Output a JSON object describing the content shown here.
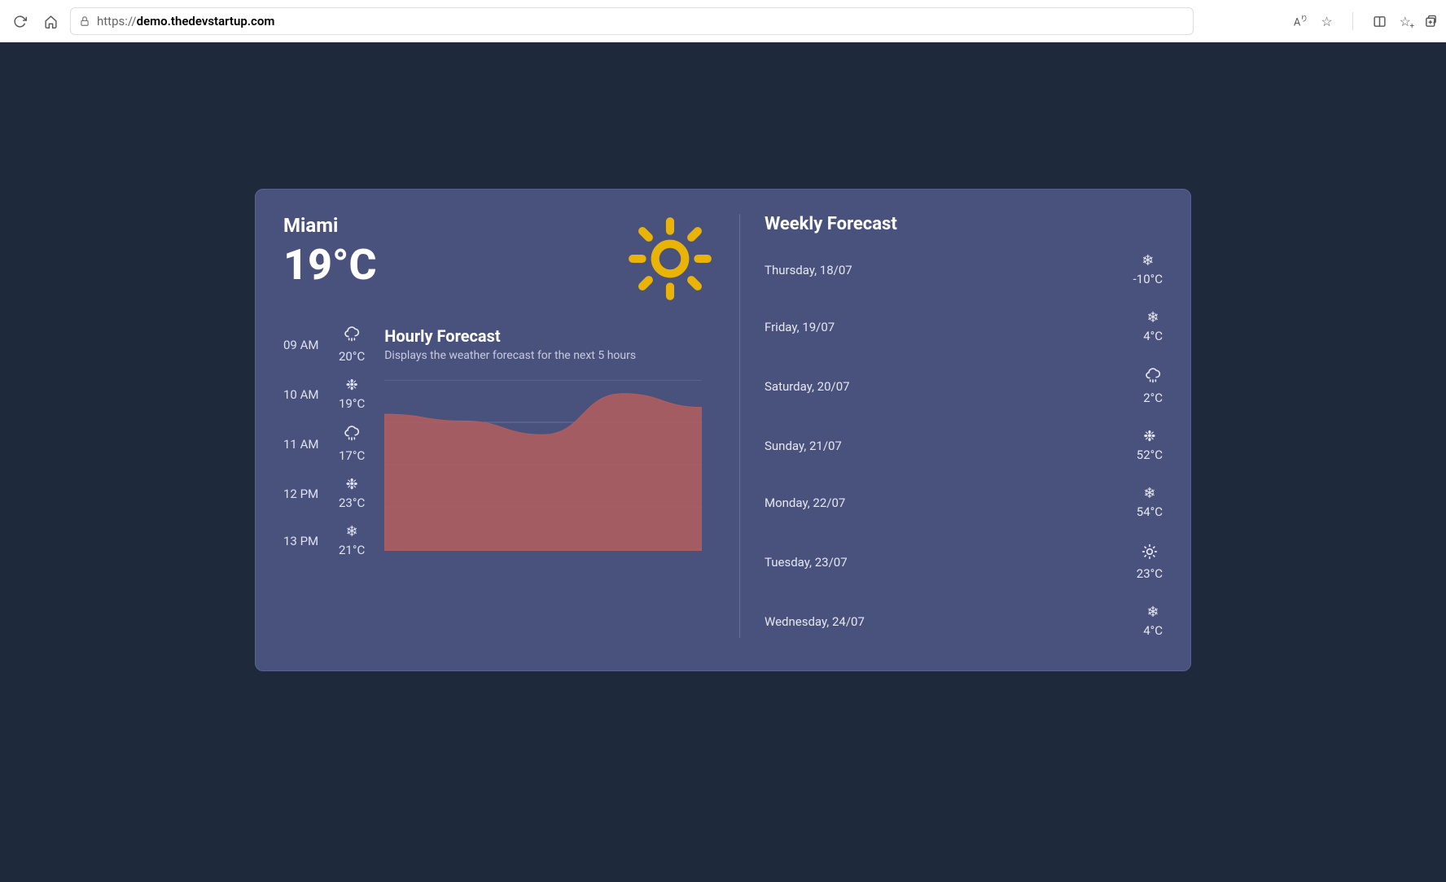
{
  "browser": {
    "url_prefix": "https://",
    "url_host": "demo.thedevstartup.com"
  },
  "current": {
    "city": "Miami",
    "temperature": "19°C",
    "icon": "sunny"
  },
  "hourly": {
    "title": "Hourly Forecast",
    "subtitle": "Displays the weather forecast for the next 5 hours",
    "items": [
      {
        "time": "09 AM",
        "temp": "20°C",
        "icon": "rain"
      },
      {
        "time": "10 AM",
        "temp": "19°C",
        "icon": "snow-alt"
      },
      {
        "time": "11 AM",
        "temp": "17°C",
        "icon": "rain"
      },
      {
        "time": "12 PM",
        "temp": "23°C",
        "icon": "snow-alt"
      },
      {
        "time": "13 PM",
        "temp": "21°C",
        "icon": "snow"
      }
    ]
  },
  "weekly": {
    "title": "Weekly Forecast",
    "items": [
      {
        "day": "Thursday, 18/07",
        "temp": "-10°C",
        "icon": "snow"
      },
      {
        "day": "Friday, 19/07",
        "temp": "4°C",
        "icon": "snow"
      },
      {
        "day": "Saturday, 20/07",
        "temp": "2°C",
        "icon": "rain"
      },
      {
        "day": "Sunday, 21/07",
        "temp": "52°C",
        "icon": "snow-alt"
      },
      {
        "day": "Monday, 22/07",
        "temp": "54°C",
        "icon": "snow"
      },
      {
        "day": "Tuesday, 23/07",
        "temp": "23°C",
        "icon": "sunny-small"
      },
      {
        "day": "Wednesday, 24/07",
        "temp": "4°C",
        "icon": "snow"
      }
    ]
  },
  "chart_data": {
    "type": "area",
    "title": "Hourly Forecast",
    "categories": [
      "09 AM",
      "10 AM",
      "11 AM",
      "12 PM",
      "13 PM"
    ],
    "values": [
      20,
      19,
      17,
      23,
      21
    ],
    "ylabel": "°C",
    "ylim": [
      0,
      25
    ]
  },
  "icons": {
    "snow": "❄",
    "snow_alt": "❉"
  }
}
